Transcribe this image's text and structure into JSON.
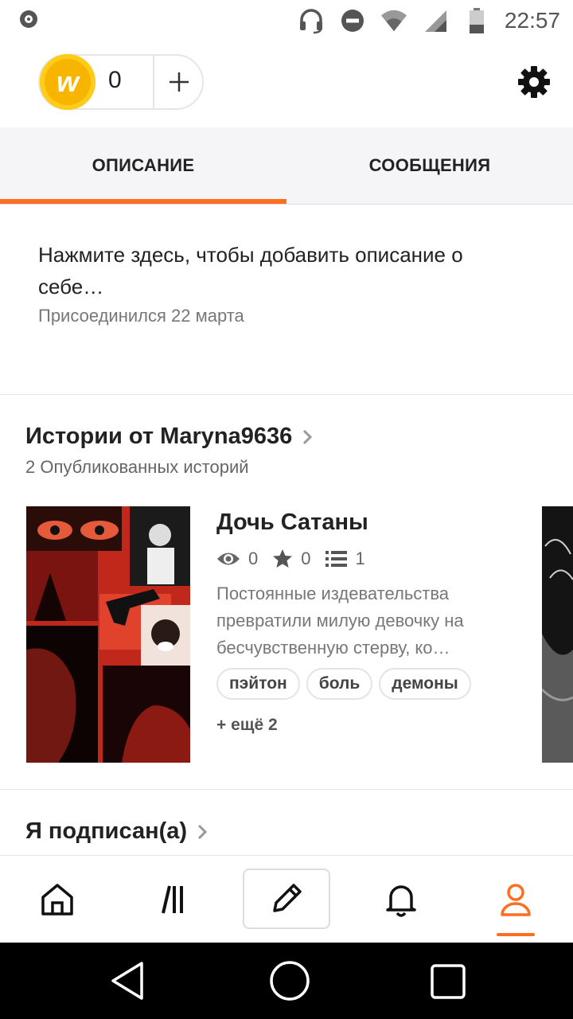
{
  "status_bar": {
    "time": "22:57"
  },
  "coins": {
    "count": "0",
    "coin_letter": "w"
  },
  "tabs": [
    {
      "label": "ОПИСАНИЕ",
      "active": true
    },
    {
      "label": "СООБЩЕНИЯ",
      "active": false
    }
  ],
  "about": {
    "placeholder": "Нажмите здесь, чтобы добавить описание о себе…",
    "joined": "Присоединился 22 марта"
  },
  "stories_section": {
    "title": "Истории от Maryna9636",
    "subtitle": "2 Опубликованных историй",
    "story": {
      "title": "Дочь Сатаны",
      "views": "0",
      "votes": "0",
      "parts": "1",
      "description": "Постоянные издевательства превратили милую девочку на бесчувственную стерву, ко…",
      "tags": [
        "пэйтон",
        "боль",
        "демоны"
      ],
      "more_tags": "+ ещё 2"
    }
  },
  "following_section": {
    "title": "Я подписан(а)"
  },
  "colors": {
    "accent": "#ff6d20"
  },
  "nav": {
    "items": [
      "home-icon",
      "library-icon",
      "write-icon",
      "notifications-icon",
      "profile-icon"
    ],
    "active": "profile-icon"
  }
}
